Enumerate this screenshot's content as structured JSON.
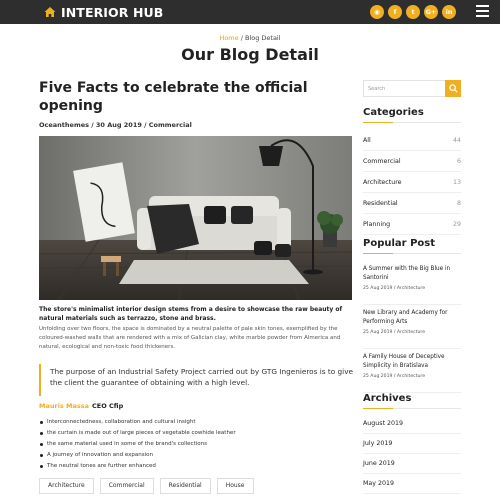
{
  "header": {
    "brand": "INTERIOR HUB",
    "socials": [
      {
        "icon": "rss-icon",
        "glyph": "◉"
      },
      {
        "icon": "facebook-icon",
        "glyph": "f"
      },
      {
        "icon": "twitter-icon",
        "glyph": "t"
      },
      {
        "icon": "google-plus-icon",
        "glyph": "G+"
      },
      {
        "icon": "linkedin-icon",
        "glyph": "in"
      }
    ],
    "accent": "#f0ae21",
    "bar_color": "#2e2e2e"
  },
  "breadcrumb": {
    "home": "Home",
    "sep_current": " / Blog Detail"
  },
  "page_title": "Our Blog Detail",
  "post": {
    "title": "Five Facts to celebrate the official opening",
    "meta": "Oceanthemes / 30 Aug 2019 / Commercial",
    "intro_bold": "The store's minimalist interior design stems from a desire to showcase the raw beauty of natural materials such as terrazzo, stone and brass.",
    "intro_text": "Unfolding over two floors, the space is dominated by a neutral palette of pale skin tones, exemplified by the coloured-washed walls that are rendered with a mix of Galician clay, white marble powder from Almerica and natural, ecological and non-toxic food thickeners.",
    "quote": "The purpose of an Industrial Safety Project carried out by GTG Ingenieros is to give the client the guarantee of obtaining with a high level.",
    "author_name": "Mauris Massa",
    "author_role": "CEO Cfip",
    "bullets": [
      "Interconnectedness, collaboration and cultural insight",
      "the curtain is made out of large pieces of vegetable cowhide leather",
      "the same material used in some of the brand's collections",
      "A journey of innovation and expansion",
      "The neutral tones are further enhanced"
    ],
    "tags": [
      "Architecture",
      "Commercial",
      "Residential",
      "House"
    ]
  },
  "sidebar": {
    "search_placeholder": "Search",
    "categories_heading": "Categories",
    "categories": [
      {
        "name": "All",
        "count": "44"
      },
      {
        "name": "Commercial",
        "count": "6"
      },
      {
        "name": "Architecture",
        "count": "13"
      },
      {
        "name": "Residential",
        "count": "8"
      },
      {
        "name": "Planning",
        "count": "29"
      }
    ],
    "popular_heading": "Popular Post",
    "popular": [
      {
        "title": "A Summer with the Big Blue in Santorini",
        "date": "25 Aug 2019 / Architecture"
      },
      {
        "title": "New Library and Academy for Performing Arts",
        "date": "25 Aug 2019 / Architecture"
      },
      {
        "title": "A Family House of Deceptive Simplicity in Bratislava",
        "date": "25 Aug 2019 / Architecture"
      }
    ],
    "archives_heading": "Archives",
    "archives": [
      "August 2019",
      "July 2019",
      "June 2019",
      "May 2019"
    ]
  }
}
